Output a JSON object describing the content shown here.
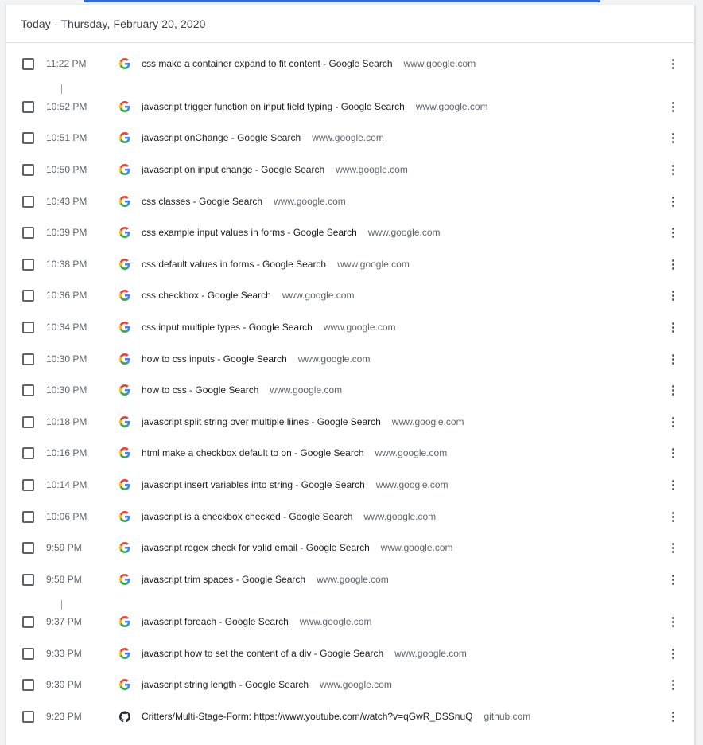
{
  "header": {
    "date_title": "Today - Thursday, February 20, 2020"
  },
  "colors": {
    "accent": "#3367d6",
    "text": "#202124",
    "secondary": "#5f6368"
  },
  "entries": [
    {
      "time": "11:22 PM",
      "title": "css make a container expand to fit content - Google Search",
      "domain": "www.google.com",
      "icon": "google-icon"
    },
    {
      "time": "10:52 PM",
      "title": "javascript trigger function on input field typing - Google Search",
      "domain": "www.google.com",
      "icon": "google-icon"
    },
    {
      "time": "10:51 PM",
      "title": "javascript onChange - Google Search",
      "domain": "www.google.com",
      "icon": "google-icon"
    },
    {
      "time": "10:50 PM",
      "title": "javascript on input change - Google Search",
      "domain": "www.google.com",
      "icon": "google-icon"
    },
    {
      "time": "10:43 PM",
      "title": "css classes - Google Search",
      "domain": "www.google.com",
      "icon": "google-icon"
    },
    {
      "time": "10:39 PM",
      "title": "css example input values in forms - Google Search",
      "domain": "www.google.com",
      "icon": "google-icon"
    },
    {
      "time": "10:38 PM",
      "title": "css default values in forms - Google Search",
      "domain": "www.google.com",
      "icon": "google-icon"
    },
    {
      "time": "10:36 PM",
      "title": "css checkbox - Google Search",
      "domain": "www.google.com",
      "icon": "google-icon"
    },
    {
      "time": "10:34 PM",
      "title": "css input multiple types - Google Search",
      "domain": "www.google.com",
      "icon": "google-icon"
    },
    {
      "time": "10:30 PM",
      "title": "how to css inputs - Google Search",
      "domain": "www.google.com",
      "icon": "google-icon"
    },
    {
      "time": "10:30 PM",
      "title": "how to css - Google Search",
      "domain": "www.google.com",
      "icon": "google-icon"
    },
    {
      "time": "10:18 PM",
      "title": "javascript split string over multiple liines - Google Search",
      "domain": "www.google.com",
      "icon": "google-icon"
    },
    {
      "time": "10:16 PM",
      "title": "html make a checkbox default to on - Google Search",
      "domain": "www.google.com",
      "icon": "google-icon"
    },
    {
      "time": "10:14 PM",
      "title": "javascript insert variables into string - Google Search",
      "domain": "www.google.com",
      "icon": "google-icon"
    },
    {
      "time": "10:06 PM",
      "title": "javascript is a checkbox checked - Google Search",
      "domain": "www.google.com",
      "icon": "google-icon"
    },
    {
      "time": "9:59 PM",
      "title": "javascript regex check for valid email - Google Search",
      "domain": "www.google.com",
      "icon": "google-icon"
    },
    {
      "time": "9:58 PM",
      "title": "javascript trim spaces - Google Search",
      "domain": "www.google.com",
      "icon": "google-icon"
    },
    {
      "time": "9:37 PM",
      "title": "javascript foreach - Google Search",
      "domain": "www.google.com",
      "icon": "google-icon"
    },
    {
      "time": "9:33 PM",
      "title": "javascript how to set the content of a div - Google Search",
      "domain": "www.google.com",
      "icon": "google-icon"
    },
    {
      "time": "9:30 PM",
      "title": "javascript string length - Google Search",
      "domain": "www.google.com",
      "icon": "google-icon"
    },
    {
      "time": "9:23 PM",
      "title": "Critters/Multi-Stage-Form: https://www.youtube.com/watch?v=qGwR_DSSnuQ",
      "domain": "github.com",
      "icon": "github-icon"
    }
  ]
}
